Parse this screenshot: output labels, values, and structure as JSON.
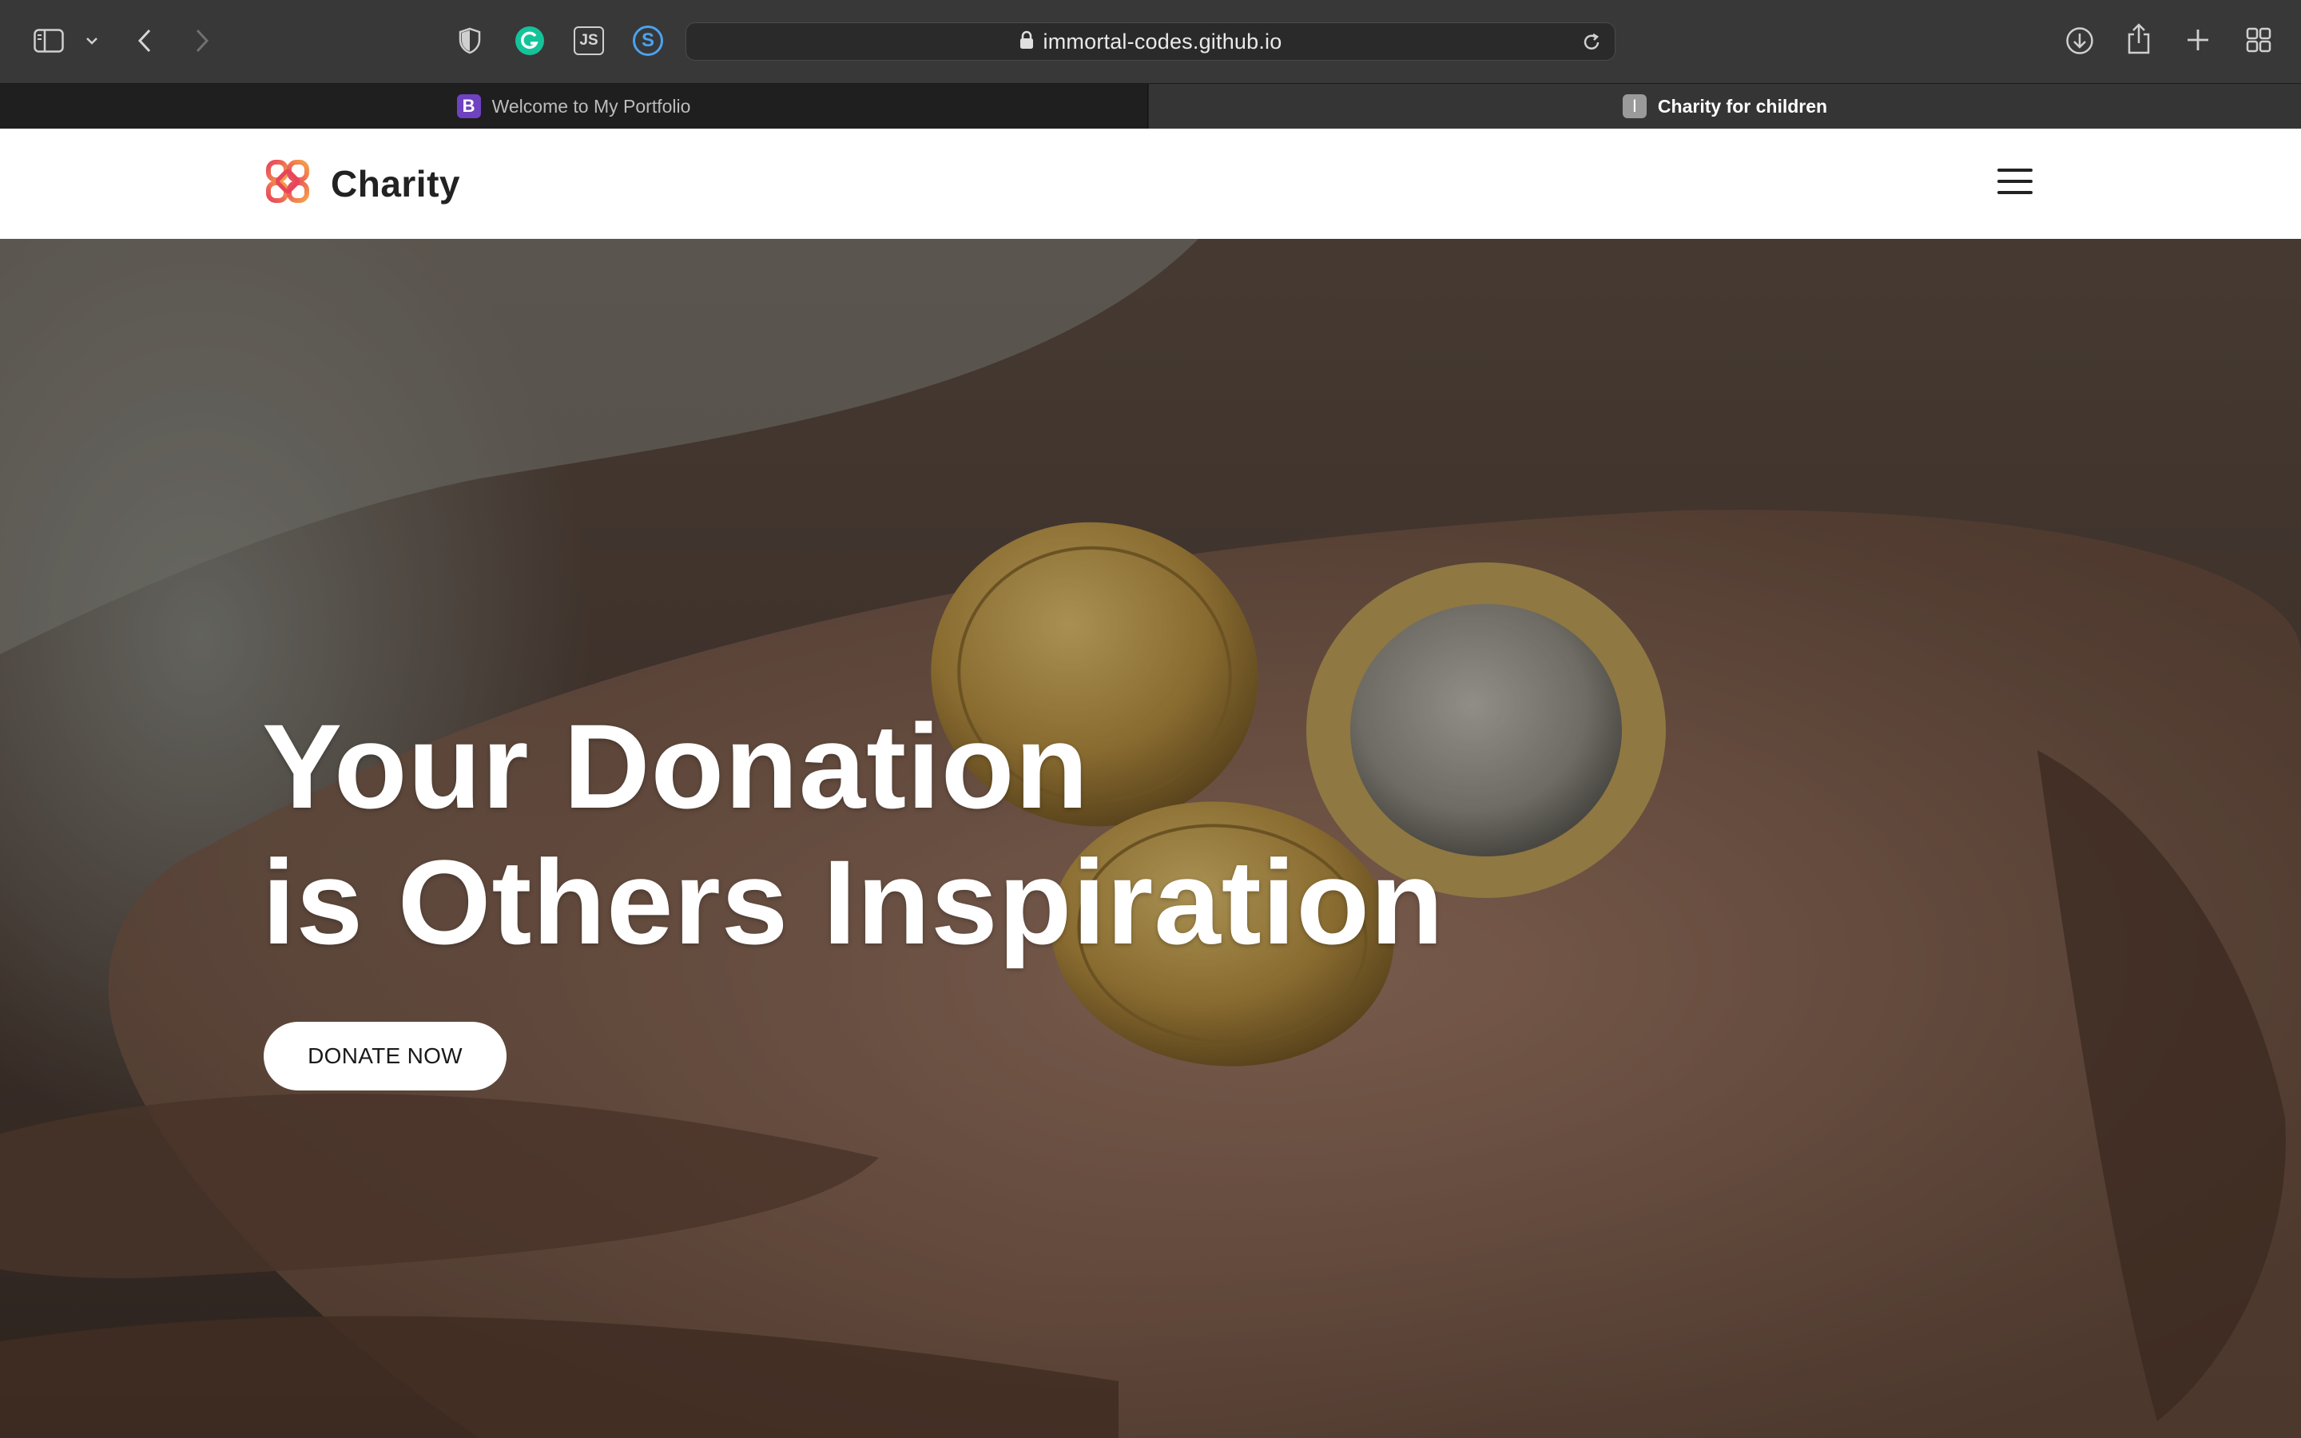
{
  "browser": {
    "url": "immortal-codes.github.io",
    "tabs": [
      {
        "label": "Welcome to My Portfolio",
        "favicon": "B",
        "active": false
      },
      {
        "label": "Charity for children",
        "favicon": "I",
        "active": true
      }
    ],
    "icons": {
      "sidebar": "sidebar-icon",
      "back": "chevron-left-icon",
      "forward": "chevron-right-icon",
      "shield": "shield-icon",
      "grammarly": "grammarly-icon",
      "js": "js-extension-icon",
      "s_ext": "s-extension-icon",
      "lock": "lock-icon",
      "reload": "reload-icon",
      "downloads": "download-icon",
      "share": "share-icon",
      "new_tab": "plus-icon",
      "tab_overview": "tab-grid-icon"
    },
    "extension_labels": {
      "js": "JS",
      "s": "S"
    }
  },
  "site": {
    "brand": "Charity",
    "hero": {
      "title_line1": "Your Donation",
      "title_line2": "is Others Inspiration",
      "cta": "DONATE NOW"
    }
  },
  "colors": {
    "chrome_bg": "#383838",
    "tab_active_bg": "#353535",
    "tab_inactive_bg": "#1f1f1f",
    "header_bg": "#ffffff",
    "cta_bg": "#ffffff",
    "logo_red": "#e8455b",
    "logo_orange": "#f5a04a"
  }
}
